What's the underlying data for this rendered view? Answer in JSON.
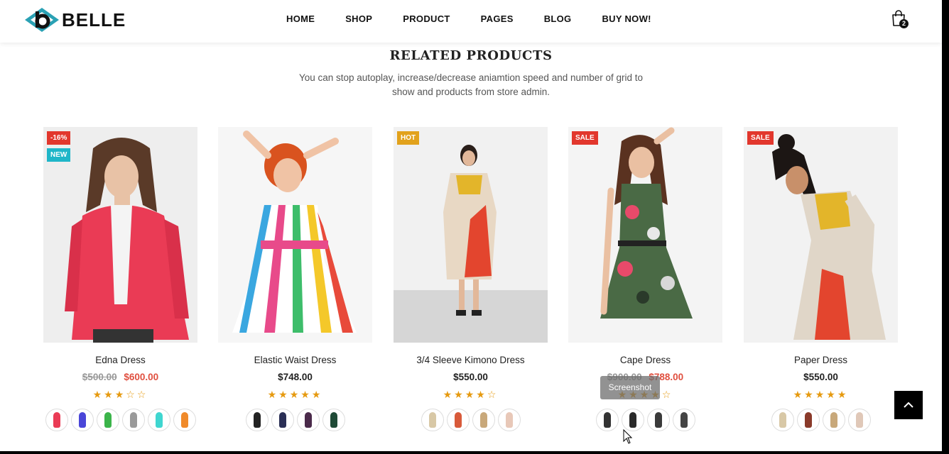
{
  "brand": {
    "name": "BELLE",
    "accent": "#2aa1b4"
  },
  "nav": [
    "HOME",
    "SHOP",
    "PRODUCT",
    "PAGES",
    "BLOG",
    "BUY NOW!"
  ],
  "cart": {
    "icon": "shopping-bag-icon",
    "count": "2"
  },
  "section": {
    "title": "RELATED PRODUCTS",
    "subtitle": "You can stop autoplay, increase/decrease aniamtion speed and number of grid to show and products from store admin."
  },
  "colors": {
    "badge_red": "#e2372d",
    "badge_blue": "#1fb6c8",
    "badge_gold": "#e2a21c",
    "sale_price": "#e04f3f",
    "star": "#e69a10"
  },
  "products": [
    {
      "name": "Edna Dress",
      "old_price": "$500.00",
      "price": "$600.00",
      "badges": [
        "-16%",
        "NEW"
      ],
      "rating": 3,
      "stars": "★★★☆☆"
    },
    {
      "name": "Elastic Waist Dress",
      "price": "$748.00",
      "badges": [],
      "rating": 5,
      "stars": "★★★★★"
    },
    {
      "name": "3/4 Sleeve Kimono Dress",
      "price": "$550.00",
      "badges": [
        "HOT"
      ],
      "rating": 4,
      "stars": "★★★★☆"
    },
    {
      "name": "Cape Dress",
      "old_price": "$900.00",
      "price": "$788.00",
      "badges": [
        "SALE"
      ],
      "rating": 4,
      "stars": "★★★★☆"
    },
    {
      "name": "Paper Dress",
      "price": "$550.00",
      "badges": [
        "SALE"
      ],
      "rating": 5,
      "stars": "★★★★★"
    }
  ],
  "tooltip": "Screenshot",
  "back_to_top_icon": "chevron-up-icon"
}
